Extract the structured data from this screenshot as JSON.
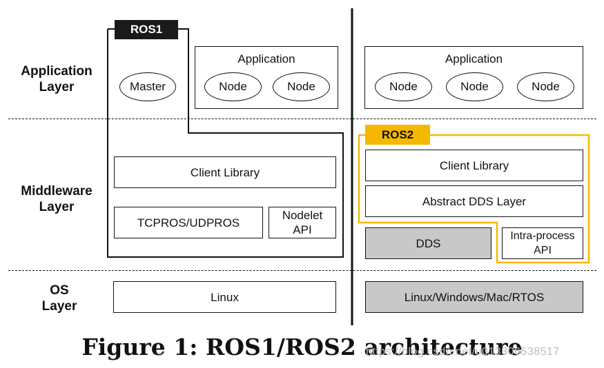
{
  "layers": {
    "application": "Application\nLayer",
    "middleware": "Middleware\nLayer",
    "os": "OS\nLayer"
  },
  "ros1": {
    "tag": "ROS1",
    "master": "Master",
    "application": {
      "title": "Application",
      "nodes": [
        "Node",
        "Node"
      ]
    },
    "client_library": "Client Library",
    "tcpros": "TCPROS/UDPROS",
    "nodelet_api": "Nodelet\nAPI",
    "os": "Linux"
  },
  "ros2": {
    "tag": "ROS2",
    "application": {
      "title": "Application",
      "nodes": [
        "Node",
        "Node",
        "Node"
      ]
    },
    "client_library": "Client Library",
    "abstract_dds": "Abstract DDS Layer",
    "dds": "DDS",
    "intra_process_api": "Intra-process\nAPI",
    "os": "Linux/Windows/Mac/RTOS"
  },
  "colors": {
    "ros1_tag_bg": "#1a1a1a",
    "ros2_accent": "#f5b800",
    "grey_box": "#c8c8c8"
  },
  "caption": "Figure 1: ROS1/ROS2 architecture",
  "watermark": "https://blog.csdn.net/u013306538517"
}
